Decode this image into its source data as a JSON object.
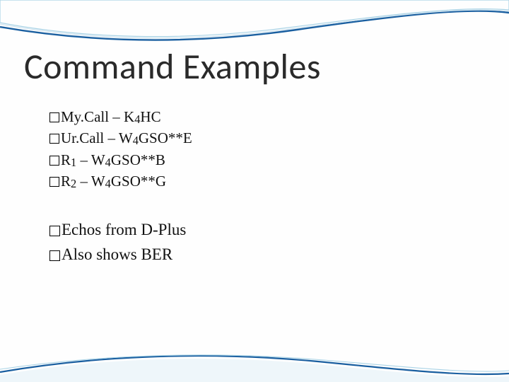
{
  "title": "Command Examples",
  "group1": {
    "items": [
      {
        "pre": "My.Call – K",
        "sub": "4",
        "post": "HC"
      },
      {
        "pre": "Ur.Call – W",
        "sub": "4",
        "post": "GSO**E"
      },
      {
        "pre": "R",
        "sub": "1",
        "post": " – W",
        "sub2": "4",
        "post2": "GSO**B"
      },
      {
        "pre": "R",
        "sub": "2",
        "post": " – W",
        "sub2": "4",
        "post2": "GSO**G"
      }
    ]
  },
  "group2": {
    "items": [
      {
        "text": "Echos from D-Plus"
      },
      {
        "text": "Also shows BER"
      }
    ]
  }
}
